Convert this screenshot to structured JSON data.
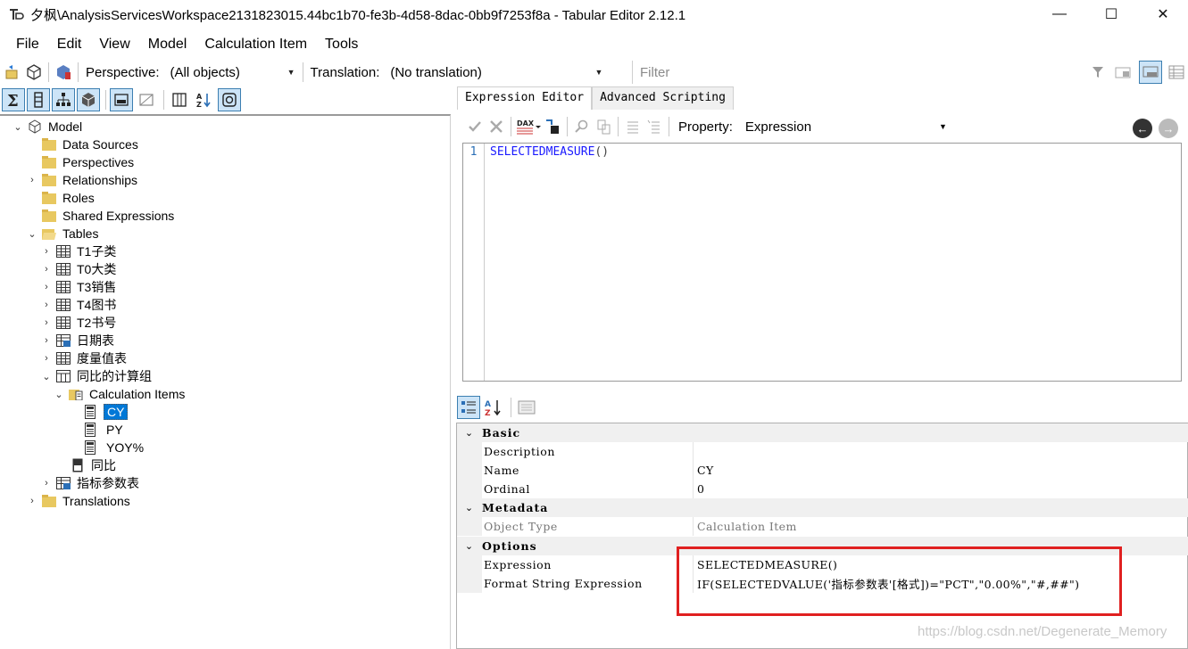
{
  "window": {
    "title": "夕枫\\AnalysisServicesWorkspace2131823015.44bc1b70-fe3b-4d58-8dac-0bb9f7253f8a - Tabular Editor 2.12.1",
    "minimize": "—",
    "maximize": "☐",
    "close": "✕"
  },
  "menu": [
    "File",
    "Edit",
    "View",
    "Model",
    "Calculation Item",
    "Tools"
  ],
  "toolbar": {
    "perspective_label": "Perspective:",
    "perspective_value": "(All objects)",
    "translation_label": "Translation:",
    "translation_value": "(No translation)",
    "filter_placeholder": "Filter"
  },
  "tree": {
    "model": "Model",
    "data_sources": "Data Sources",
    "perspectives": "Perspectives",
    "relationships": "Relationships",
    "roles": "Roles",
    "shared_expressions": "Shared Expressions",
    "tables": "Tables",
    "table_items": [
      "T1子类",
      "T0大类",
      "T3销售",
      "T4图书",
      "T2书号",
      "日期表",
      "度量值表",
      "同比的计算组"
    ],
    "calculation_items": "Calculation Items",
    "calc_items": [
      "CY",
      "PY",
      "YOY%"
    ],
    "measure": "同比",
    "param_table": "指标参数表",
    "translations": "Translations"
  },
  "editor": {
    "tabs": [
      "Expression Editor",
      "Advanced Scripting"
    ],
    "property_label": "Property:",
    "property_value": "Expression",
    "line_number": "1",
    "code_fn": "SELECTEDMEASURE",
    "code_paren": "()"
  },
  "properties": {
    "basic": "Basic",
    "description": "Description",
    "description_value": "",
    "name": "Name",
    "name_value": "CY",
    "ordinal": "Ordinal",
    "ordinal_value": "0",
    "metadata": "Metadata",
    "object_type": "Object Type",
    "object_type_value": "Calculation Item",
    "options": "Options",
    "expression": "Expression",
    "expression_value": "SELECTEDMEASURE()",
    "format_string": "Format String Expression",
    "format_string_value": "IF(SELECTEDVALUE('指标参数表'[格式])=\"PCT\",\"0.00%\",\"#,##\")"
  },
  "watermark": "https://blog.csdn.net/Degenerate_Memory",
  "colors": {
    "accent": "#0078d7",
    "folder": "#e8c860",
    "highlight": "#e02020",
    "code_fn": "#1a1aff"
  }
}
